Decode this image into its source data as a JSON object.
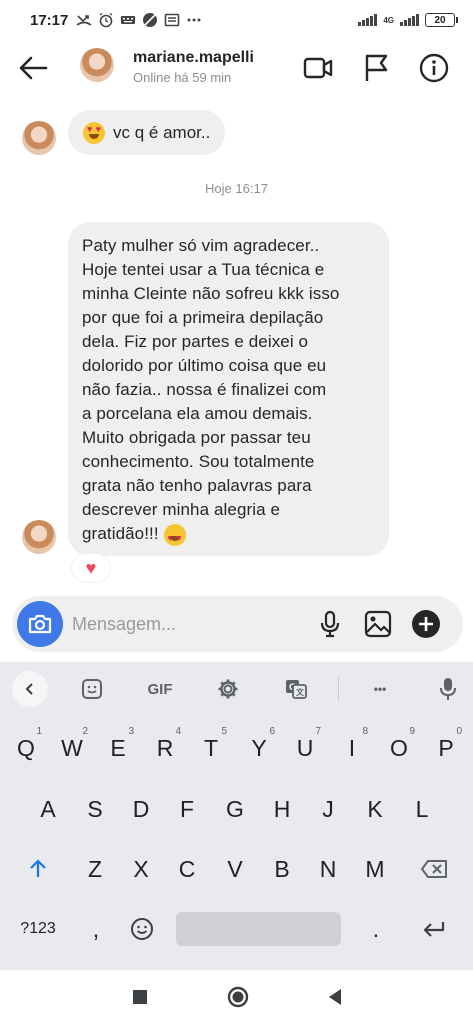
{
  "status_bar": {
    "time": "17:17",
    "network_label": "4G",
    "battery": "20"
  },
  "header": {
    "username": "mariane.mapelli",
    "status": "Online há 59 min",
    "icons": [
      "back-arrow-icon",
      "video-call-icon",
      "flag-icon",
      "info-icon"
    ]
  },
  "messages": [
    {
      "sender": "them",
      "text": "vc q é  amor..",
      "emoji": "heart-eyes"
    },
    {
      "type": "timestamp",
      "text": "Hoje 16:17"
    },
    {
      "sender": "them",
      "text": "Paty mulher só vim agradecer..\nHoje tentei usar a Tua técnica e\nminha Cleinte não sofreu kkk isso\npor que foi a primeira depilação\ndela. Fiz por partes e deixei o\ndolorido por último coisa que  eu\nnão fazia.. nossa é finalizei com\na porcelana ela amou demais.\nMuito obrigada por passar teu\nconhecimento. Sou totalmente\ngrata não tenho palavras para\ndescrever minha alegria e\ngratidão!!!",
      "emoji": "heart-eyes",
      "reaction": "♥"
    }
  ],
  "composer": {
    "placeholder": "Mensagem...",
    "icons": [
      "camera-icon",
      "microphone-icon",
      "image-icon",
      "add-icon"
    ]
  },
  "keyboard": {
    "toolbar": {
      "gif_label": "GIF",
      "more_label": "•••",
      "icons": [
        "chevron-left-icon",
        "sticker-icon",
        "gear-icon",
        "translate-icon",
        "microphone-icon"
      ]
    },
    "row1": [
      {
        "k": "Q",
        "n": "1"
      },
      {
        "k": "W",
        "n": "2"
      },
      {
        "k": "E",
        "n": "3"
      },
      {
        "k": "R",
        "n": "4"
      },
      {
        "k": "T",
        "n": "5"
      },
      {
        "k": "Y",
        "n": "6"
      },
      {
        "k": "U",
        "n": "7"
      },
      {
        "k": "I",
        "n": "8"
      },
      {
        "k": "O",
        "n": "9"
      },
      {
        "k": "P",
        "n": "0"
      }
    ],
    "row2": [
      "A",
      "S",
      "D",
      "F",
      "G",
      "H",
      "J",
      "K",
      "L"
    ],
    "row3": [
      "Z",
      "X",
      "C",
      "V",
      "B",
      "N",
      "M"
    ],
    "bottom": {
      "symbols_label": "?123",
      "comma": ",",
      "period": "."
    }
  },
  "nav_bar": {
    "icons": [
      "recents-icon",
      "home-icon",
      "back-icon"
    ]
  },
  "colors": {
    "accent_blue": "#3f79e8",
    "bubble_bg": "#efefef",
    "reaction_red": "#ed4956",
    "keyboard_bg": "#e8eaed",
    "shift_blue": "#1a73e8"
  }
}
